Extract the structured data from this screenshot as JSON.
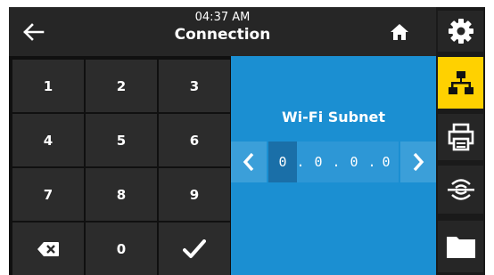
{
  "header": {
    "time": "04:37 AM",
    "title": "Connection"
  },
  "keypad": {
    "keys": [
      "1",
      "2",
      "3",
      "4",
      "5",
      "6",
      "7",
      "8",
      "9",
      "0"
    ]
  },
  "entry": {
    "label": "Wi-Fi Subnet",
    "octets": [
      "0",
      "0",
      "0",
      "0"
    ],
    "separator": ".",
    "active_octet_index": 0
  },
  "sidebar": {
    "items": [
      {
        "icon": "gear-icon",
        "active": false
      },
      {
        "icon": "network-icon",
        "active": true
      },
      {
        "icon": "printer-icon",
        "active": false
      },
      {
        "icon": "sensor-icon",
        "active": false
      },
      {
        "icon": "folder-icon",
        "active": false
      }
    ]
  },
  "colors": {
    "accent_yellow": "#ffd100",
    "entry_blue": "#1b8fd2",
    "key_bg": "#2c2c2c",
    "header_bg": "#262626"
  }
}
